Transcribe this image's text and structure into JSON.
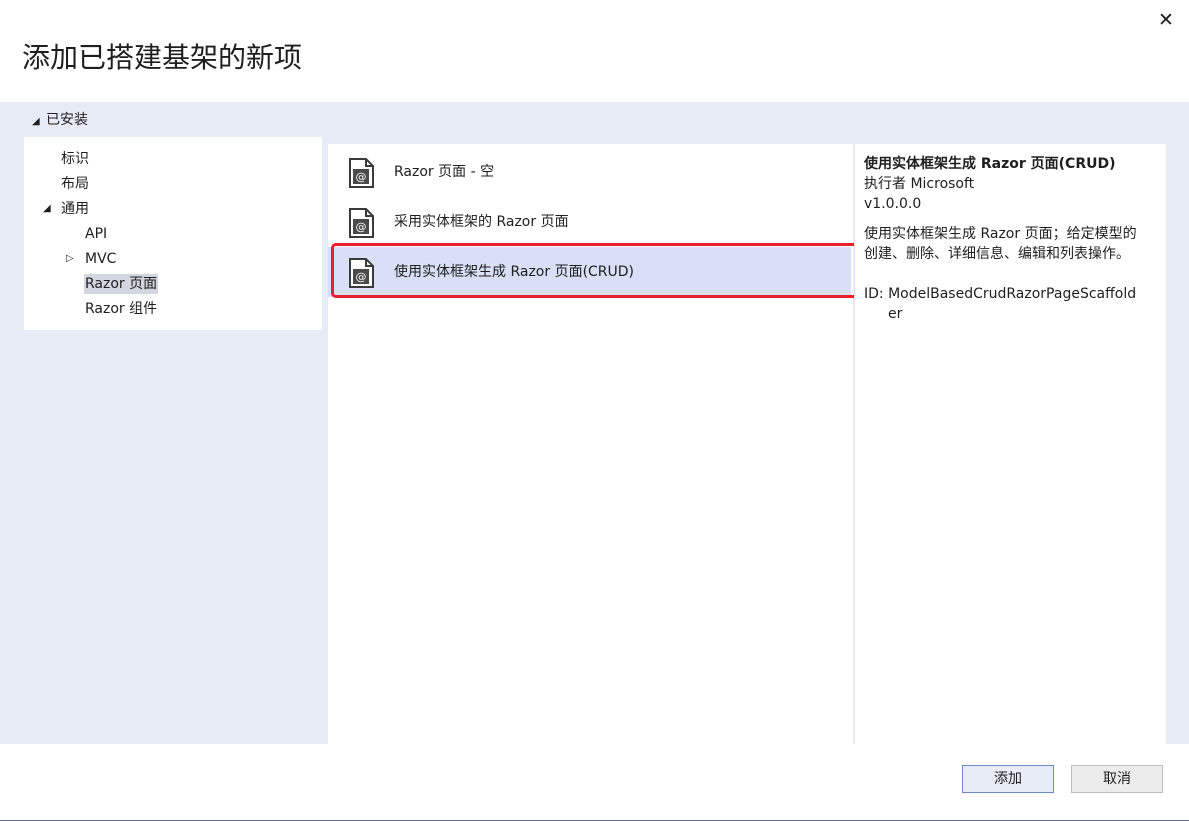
{
  "dialog": {
    "title": "添加已搭建基架的新项",
    "close_glyph": "✕"
  },
  "tree": {
    "root_label": "已安装",
    "expanded_glyph": "◢",
    "collapsed_glyph": "▷",
    "items": [
      {
        "label": "标识"
      },
      {
        "label": "布局"
      },
      {
        "label": "通用"
      },
      {
        "label": "API"
      },
      {
        "label": "MVC"
      },
      {
        "label": "Razor 页面",
        "selected": true
      },
      {
        "label": "Razor 组件"
      }
    ]
  },
  "templates": {
    "icon": "razor-file-icon",
    "items": [
      {
        "label": "Razor 页面 - 空"
      },
      {
        "label": "采用实体框架的 Razor 页面"
      },
      {
        "label": "使用实体框架生成 Razor 页面(CRUD)",
        "selected": true
      }
    ]
  },
  "details": {
    "title": "使用实体框架生成 Razor 页面(CRUD)",
    "author": "执行者 Microsoft",
    "version": "v1.0.0.0",
    "description_line1": "使用实体框架生成 Razor 页面；给定模型的",
    "description_line2": "创建、删除、详细信息、编辑和列表操作。",
    "id_line1": "ID: ModelBasedCrudRazorPageScaffold",
    "id_line2": "er"
  },
  "footer": {
    "add_label": "添加",
    "cancel_label": "取消"
  },
  "colors": {
    "highlight_box": "#e8202a",
    "selected_item": "#d8dff6",
    "body_background": "#e6ebf5"
  }
}
